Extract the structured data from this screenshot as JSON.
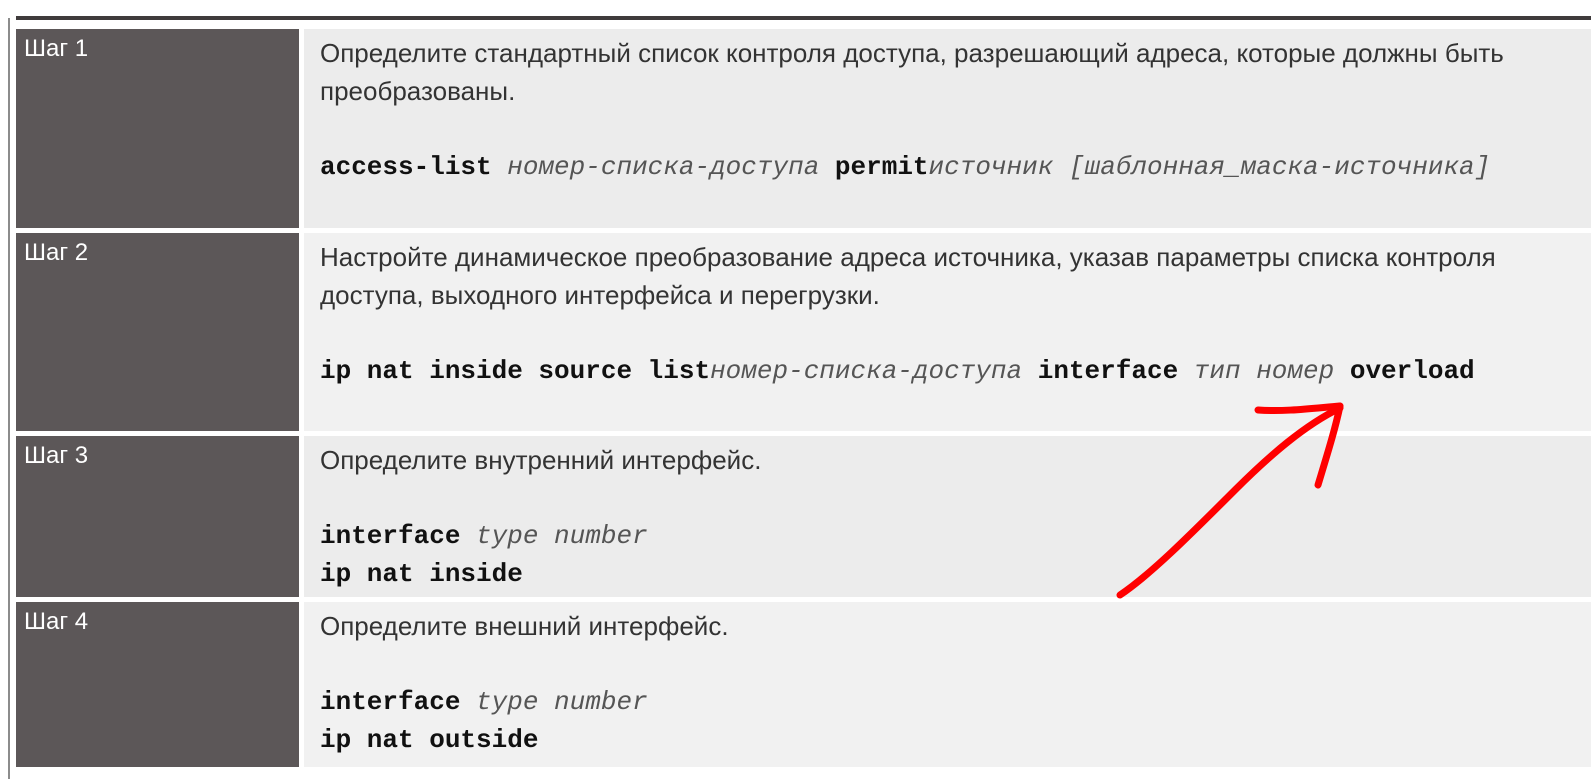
{
  "steps": [
    {
      "label": "Шаг 1",
      "description": "Определите стандартный список контроля доступа, разрешающий адреса, которые должны быть преобразованы.",
      "cmd": {
        "kw1": "access-list",
        "arg1": "номер-списка-доступа",
        "kw2": "permit",
        "arg2": "источник",
        "arg3": "[шаблонная_маска-источника]"
      }
    },
    {
      "label": "Шаг 2",
      "description": "Настройте динамическое преобразование адреса источника, указав параметры списка контроля доступа, выходного интерфейса и перегрузки.",
      "cmd": {
        "kw1": "ip nat inside source list",
        "arg1": "номер-списка-доступа",
        "kw2": "interface",
        "arg2": "тип номер",
        "kw3": "overload"
      }
    },
    {
      "label": "Шаг 3",
      "description": "Определите внутренний интерфейс.",
      "cmd": {
        "kw1": "interface",
        "arg1": "type number",
        "kw2": "ip nat inside"
      }
    },
    {
      "label": "Шаг 4",
      "description": "Определите внешний интерфейс.",
      "cmd": {
        "kw1": "interface",
        "arg1": "type number",
        "kw2": "ip nat outside"
      }
    }
  ],
  "colors": {
    "step_cell": "#5c5758",
    "content_cell": "#ececec",
    "annotation_arrow": "#ff0000"
  },
  "annotation": {
    "shape": "arrow-icon",
    "points_to": "interface"
  }
}
